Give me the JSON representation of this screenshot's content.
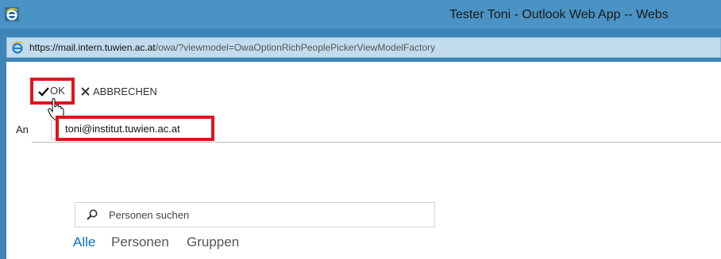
{
  "window": {
    "title": "Tester Toni - Outlook Web App -- Webs",
    "app_icon": "internet-explorer-icon"
  },
  "address_bar": {
    "url_prefix": "https://mail.intern.",
    "url_domain": "tuwien.ac.at",
    "url_path": "/owa/?viewmodel=OwaOptionRichPeoplePickerViewModelFactory",
    "icon": "internet-explorer-icon"
  },
  "toolbar": {
    "ok_label": "OK",
    "ok_icon": "checkmark-icon",
    "cancel_label": "ABBRECHEN",
    "cancel_icon": "close-icon"
  },
  "recipient": {
    "to_label": "An",
    "to_value": "toni@institut.tuwien.ac.at"
  },
  "search": {
    "placeholder": "Personen suchen",
    "icon": "search-icon"
  },
  "filters": {
    "all": "Alle",
    "people": "Personen",
    "groups": "Gruppen",
    "active": "Alle"
  },
  "colors": {
    "titlebar": "#4a93c4",
    "highlight": "#e0141e",
    "accent_link": "#0072c6"
  }
}
